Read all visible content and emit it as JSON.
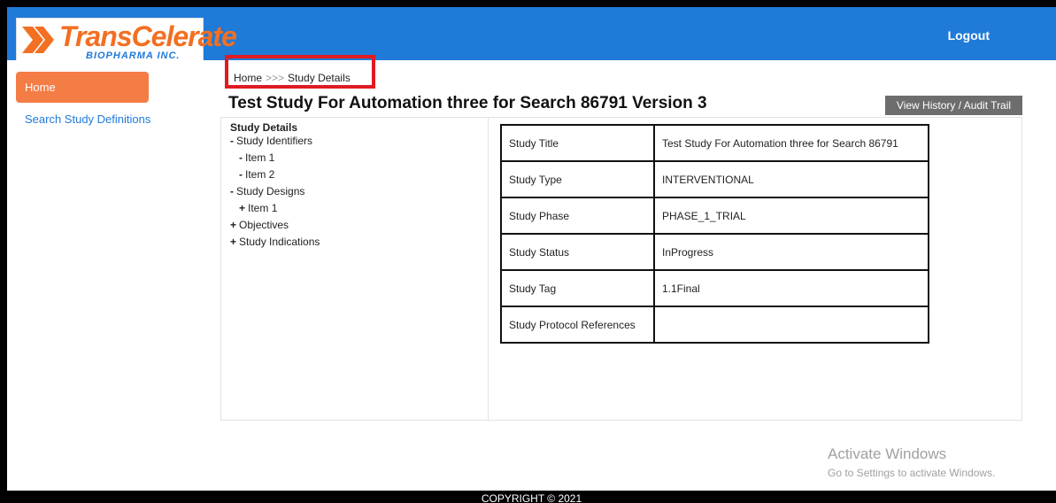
{
  "header": {
    "logo_main": "TransCelerate",
    "logo_sub": "BIOPHARMA INC.",
    "logout_label": "Logout",
    "bar_color": "#1f7ad8"
  },
  "sidebar": {
    "home_label": "Home",
    "home_color": "#f47c45",
    "search_label": "Search Study Definitions"
  },
  "breadcrumb": {
    "home": "Home",
    "separator": ">>>",
    "current": "Study Details",
    "highlight_color": "#e11b22"
  },
  "page": {
    "title": "Test Study For Automation three for Search 86791 Version 3",
    "history_button": "View History / Audit Trail"
  },
  "tree": {
    "root": "Study Details",
    "items": [
      {
        "marker": "-",
        "label": "Study Identifiers",
        "level": 1
      },
      {
        "marker": "-",
        "label": "Item 1",
        "level": 2
      },
      {
        "marker": "-",
        "label": "Item 2",
        "level": 2
      },
      {
        "marker": "-",
        "label": "Study Designs",
        "level": 1
      },
      {
        "marker": "+",
        "label": "Item 1",
        "level": 2
      },
      {
        "marker": "+",
        "label": "Objectives",
        "level": 1
      },
      {
        "marker": "+",
        "label": "Study Indications",
        "level": 1
      }
    ]
  },
  "details": [
    {
      "key": "Study Title",
      "value": "Test Study For Automation three for Search 86791"
    },
    {
      "key": "Study Type",
      "value": "INTERVENTIONAL"
    },
    {
      "key": "Study Phase",
      "value": "PHASE_1_TRIAL"
    },
    {
      "key": "Study Status",
      "value": "InProgress"
    },
    {
      "key": "Study Tag",
      "value": "1.1Final"
    },
    {
      "key": "Study Protocol References",
      "value": ""
    }
  ],
  "watermark": {
    "line1": "Activate Windows",
    "line2": "Go to Settings to activate Windows."
  },
  "footer": {
    "copyright": "COPYRIGHT © 2021"
  }
}
